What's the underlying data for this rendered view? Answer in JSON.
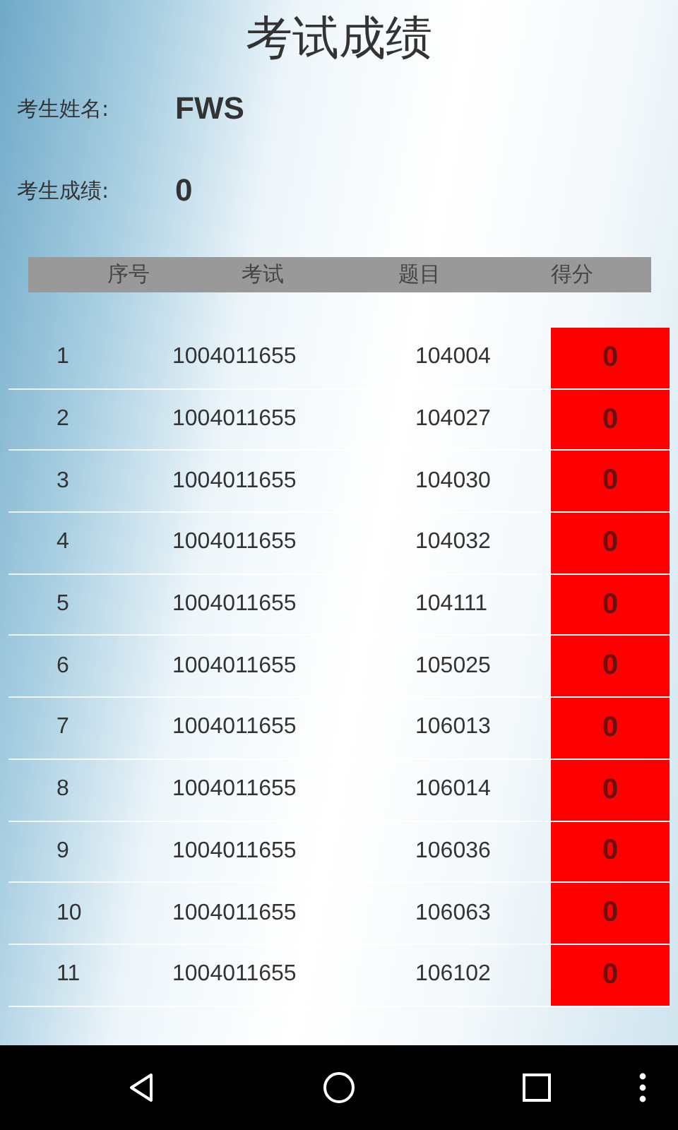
{
  "title": "考试成绩",
  "student": {
    "name_label": "考生姓名:",
    "name": "FWS",
    "score_label": "考生成绩:",
    "score": "0"
  },
  "table": {
    "columns": [
      "序号",
      "考试",
      "题目",
      "得分"
    ],
    "rows": [
      {
        "no": "1",
        "exam": "1004011655",
        "question": "104004",
        "score": "0"
      },
      {
        "no": "2",
        "exam": "1004011655",
        "question": "104027",
        "score": "0"
      },
      {
        "no": "3",
        "exam": "1004011655",
        "question": "104030",
        "score": "0"
      },
      {
        "no": "4",
        "exam": "1004011655",
        "question": "104032",
        "score": "0"
      },
      {
        "no": "5",
        "exam": "1004011655",
        "question": "104111",
        "score": "0"
      },
      {
        "no": "6",
        "exam": "1004011655",
        "question": "105025",
        "score": "0"
      },
      {
        "no": "7",
        "exam": "1004011655",
        "question": "106013",
        "score": "0"
      },
      {
        "no": "8",
        "exam": "1004011655",
        "question": "106014",
        "score": "0"
      },
      {
        "no": "9",
        "exam": "1004011655",
        "question": "106036",
        "score": "0"
      },
      {
        "no": "10",
        "exam": "1004011655",
        "question": "106063",
        "score": "0"
      },
      {
        "no": "11",
        "exam": "1004011655",
        "question": "106102",
        "score": "0"
      }
    ]
  }
}
